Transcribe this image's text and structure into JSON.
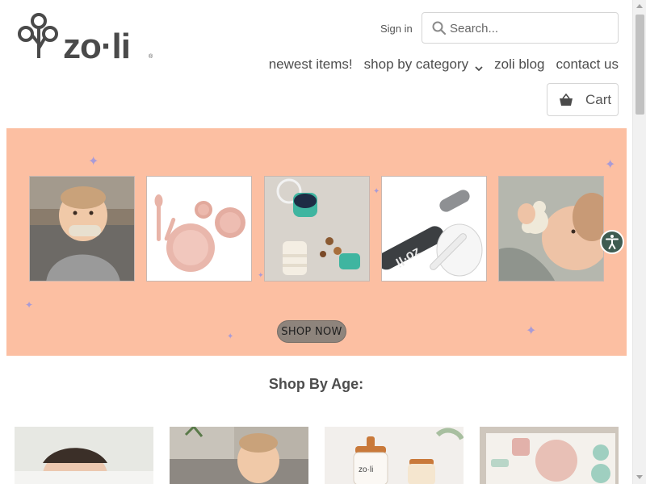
{
  "header": {
    "logo_text": "zo·li",
    "sign_in_label": "Sign in",
    "search": {
      "placeholder": "Search...",
      "value": ""
    },
    "nav": [
      {
        "label": "newest items!"
      },
      {
        "label": "shop by category"
      },
      {
        "label": "zoli blog"
      },
      {
        "label": "contact us"
      }
    ],
    "cart_label": "Cart"
  },
  "banner": {
    "tiles": [
      {
        "name": "baby-teether-photo",
        "icon": "baby-with-teether"
      },
      {
        "name": "pink-dish-set-photo",
        "icon": "pink-plate-bowl-cup-spoons"
      },
      {
        "name": "snack-cups-photo",
        "icon": "snack-containers"
      },
      {
        "name": "toothbrush-photo",
        "icon": "baby-toothbrush"
      },
      {
        "name": "baby-lying-teether-photo",
        "icon": "baby-with-teether"
      }
    ],
    "button_label": "SHOP NOW",
    "background_color": "#fcbfa2",
    "button_color": "#8e847c"
  },
  "shop_by_age": {
    "title": "Shop By Age:",
    "cards": [
      {
        "name": "age-card-newborn"
      },
      {
        "name": "age-card-infant"
      },
      {
        "name": "age-card-toddler-cups"
      },
      {
        "name": "age-card-dish-set"
      }
    ]
  },
  "accessibility": {
    "icon": "accessibility-icon",
    "color": "#3f5c52"
  }
}
